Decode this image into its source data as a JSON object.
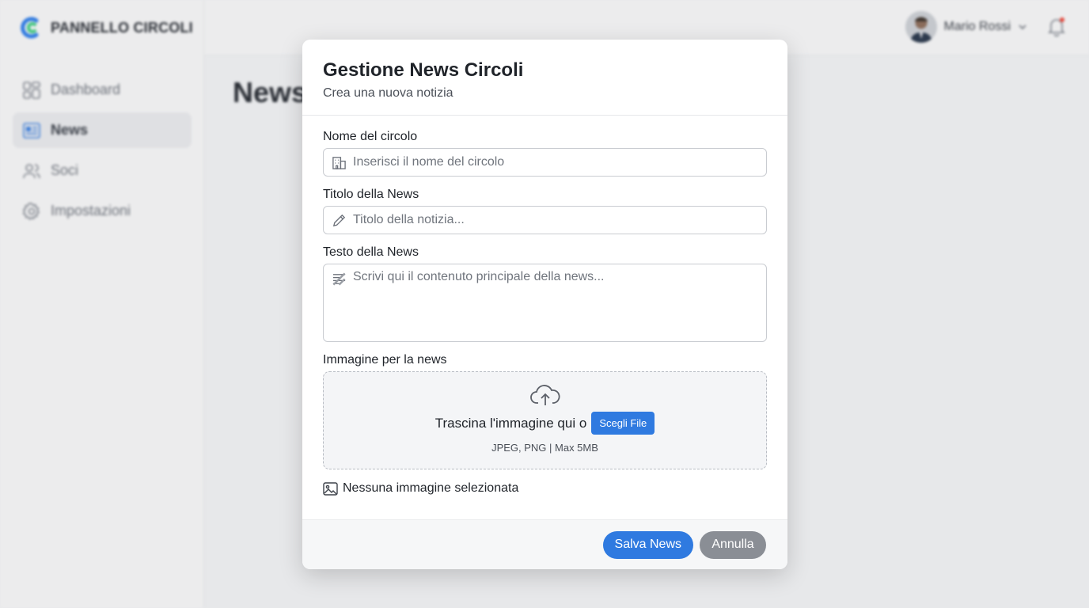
{
  "brand": {
    "name": "PANNELLO CIRCOLI"
  },
  "sidebar": {
    "items": [
      {
        "label": "Dashboard",
        "icon": "dashboard-icon",
        "active": false
      },
      {
        "label": "News",
        "icon": "news-icon",
        "active": true
      },
      {
        "label": "Soci",
        "icon": "users-icon",
        "active": false
      },
      {
        "label": "Impostazioni",
        "icon": "gear-icon",
        "active": false
      }
    ]
  },
  "topbar": {
    "user_name": "Mario Rossi",
    "notification_dot_color": "#e5483c"
  },
  "page": {
    "title": "News"
  },
  "modal": {
    "title": "Gestione News Circoli",
    "subtitle": "Crea una nuova notizia",
    "fields": {
      "circle_name": {
        "label": "Nome del circolo",
        "placeholder": "Inserisci il nome del circolo",
        "value": ""
      },
      "news_title": {
        "label": "Titolo della News",
        "placeholder": "Titolo della notizia...",
        "value": ""
      },
      "news_text": {
        "label": "Testo della News",
        "placeholder": "Scrivi qui il contenuto principale della news...",
        "value": ""
      }
    },
    "image": {
      "label": "Immagine per la news",
      "drop_text": "Trascina l'immagine qui o",
      "choose_button": "Scegli File",
      "hint": "JPEG, PNG | Max 5MB",
      "status": "Nessuna immagine selezionata"
    },
    "buttons": {
      "save": "Salva News",
      "cancel": "Annulla"
    }
  },
  "colors": {
    "primary": "#2f7ae0",
    "secondary": "#8a8e95",
    "logo_blue": "#2f7ae0",
    "logo_green": "#3cc47c"
  }
}
